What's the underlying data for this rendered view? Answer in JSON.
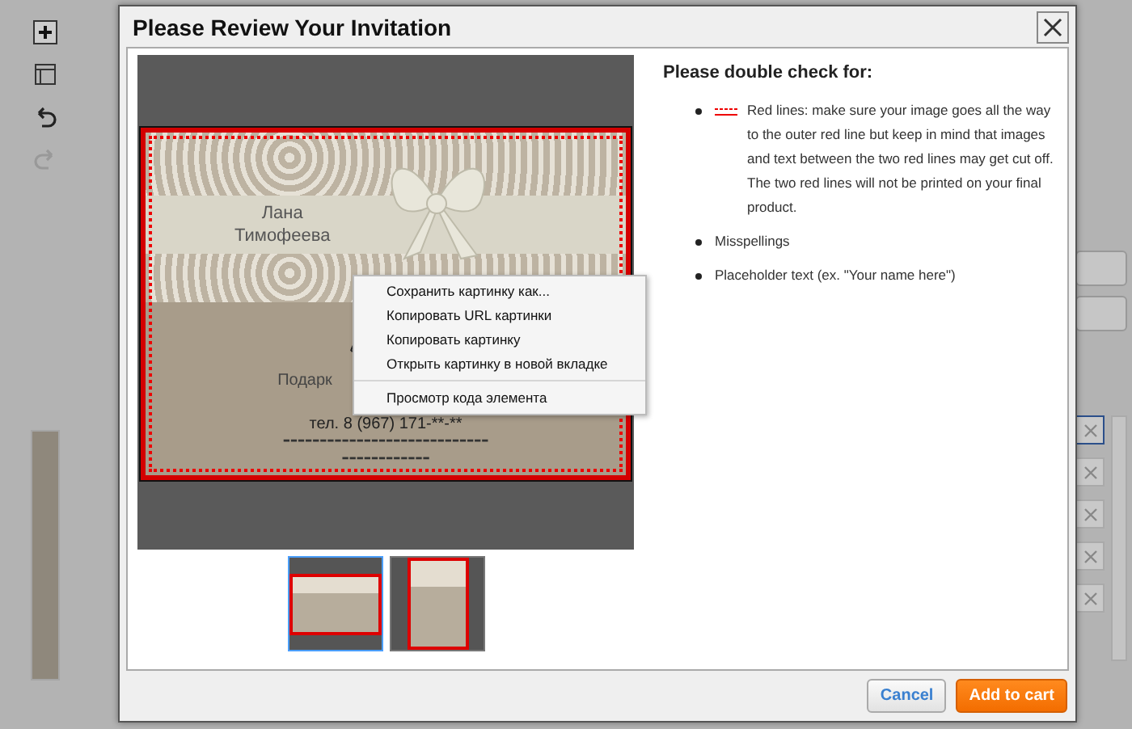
{
  "dialog": {
    "title": "Please Review Your Invitation",
    "card": {
      "name_lines": [
        "Лана",
        "Тимофеева"
      ],
      "subtitle": "Подарк",
      "phone": "тел. 8 (967) 171-**-**"
    },
    "context_menu": [
      {
        "label": "Сохранить картинку как...",
        "divider_after": false
      },
      {
        "label": "Копировать URL картинки",
        "divider_after": false
      },
      {
        "label": "Копировать картинку",
        "divider_after": false
      },
      {
        "label": "Открыть картинку в новой вкладке",
        "divider_after": true
      },
      {
        "label": "Просмотр кода элемента",
        "divider_after": false
      }
    ],
    "thumbnails": [
      {
        "kind": "landscape",
        "selected": true
      },
      {
        "kind": "portrait",
        "selected": false
      }
    ],
    "checklist": {
      "heading": "Please double check for:",
      "items": [
        {
          "kind": "redline",
          "text": "Red lines: make sure your image goes all the way to the outer red line but keep in mind that images and text between the two red lines may get cut off. The two red lines will not be printed on your final product."
        },
        {
          "kind": "plain",
          "text": "Misspellings"
        },
        {
          "kind": "plain",
          "text": "Placeholder text (ex. \"Your name here\")"
        }
      ]
    },
    "buttons": [
      {
        "kind": "cancel",
        "label": "Cancel"
      },
      {
        "kind": "primary",
        "label": "Add to cart"
      }
    ]
  }
}
